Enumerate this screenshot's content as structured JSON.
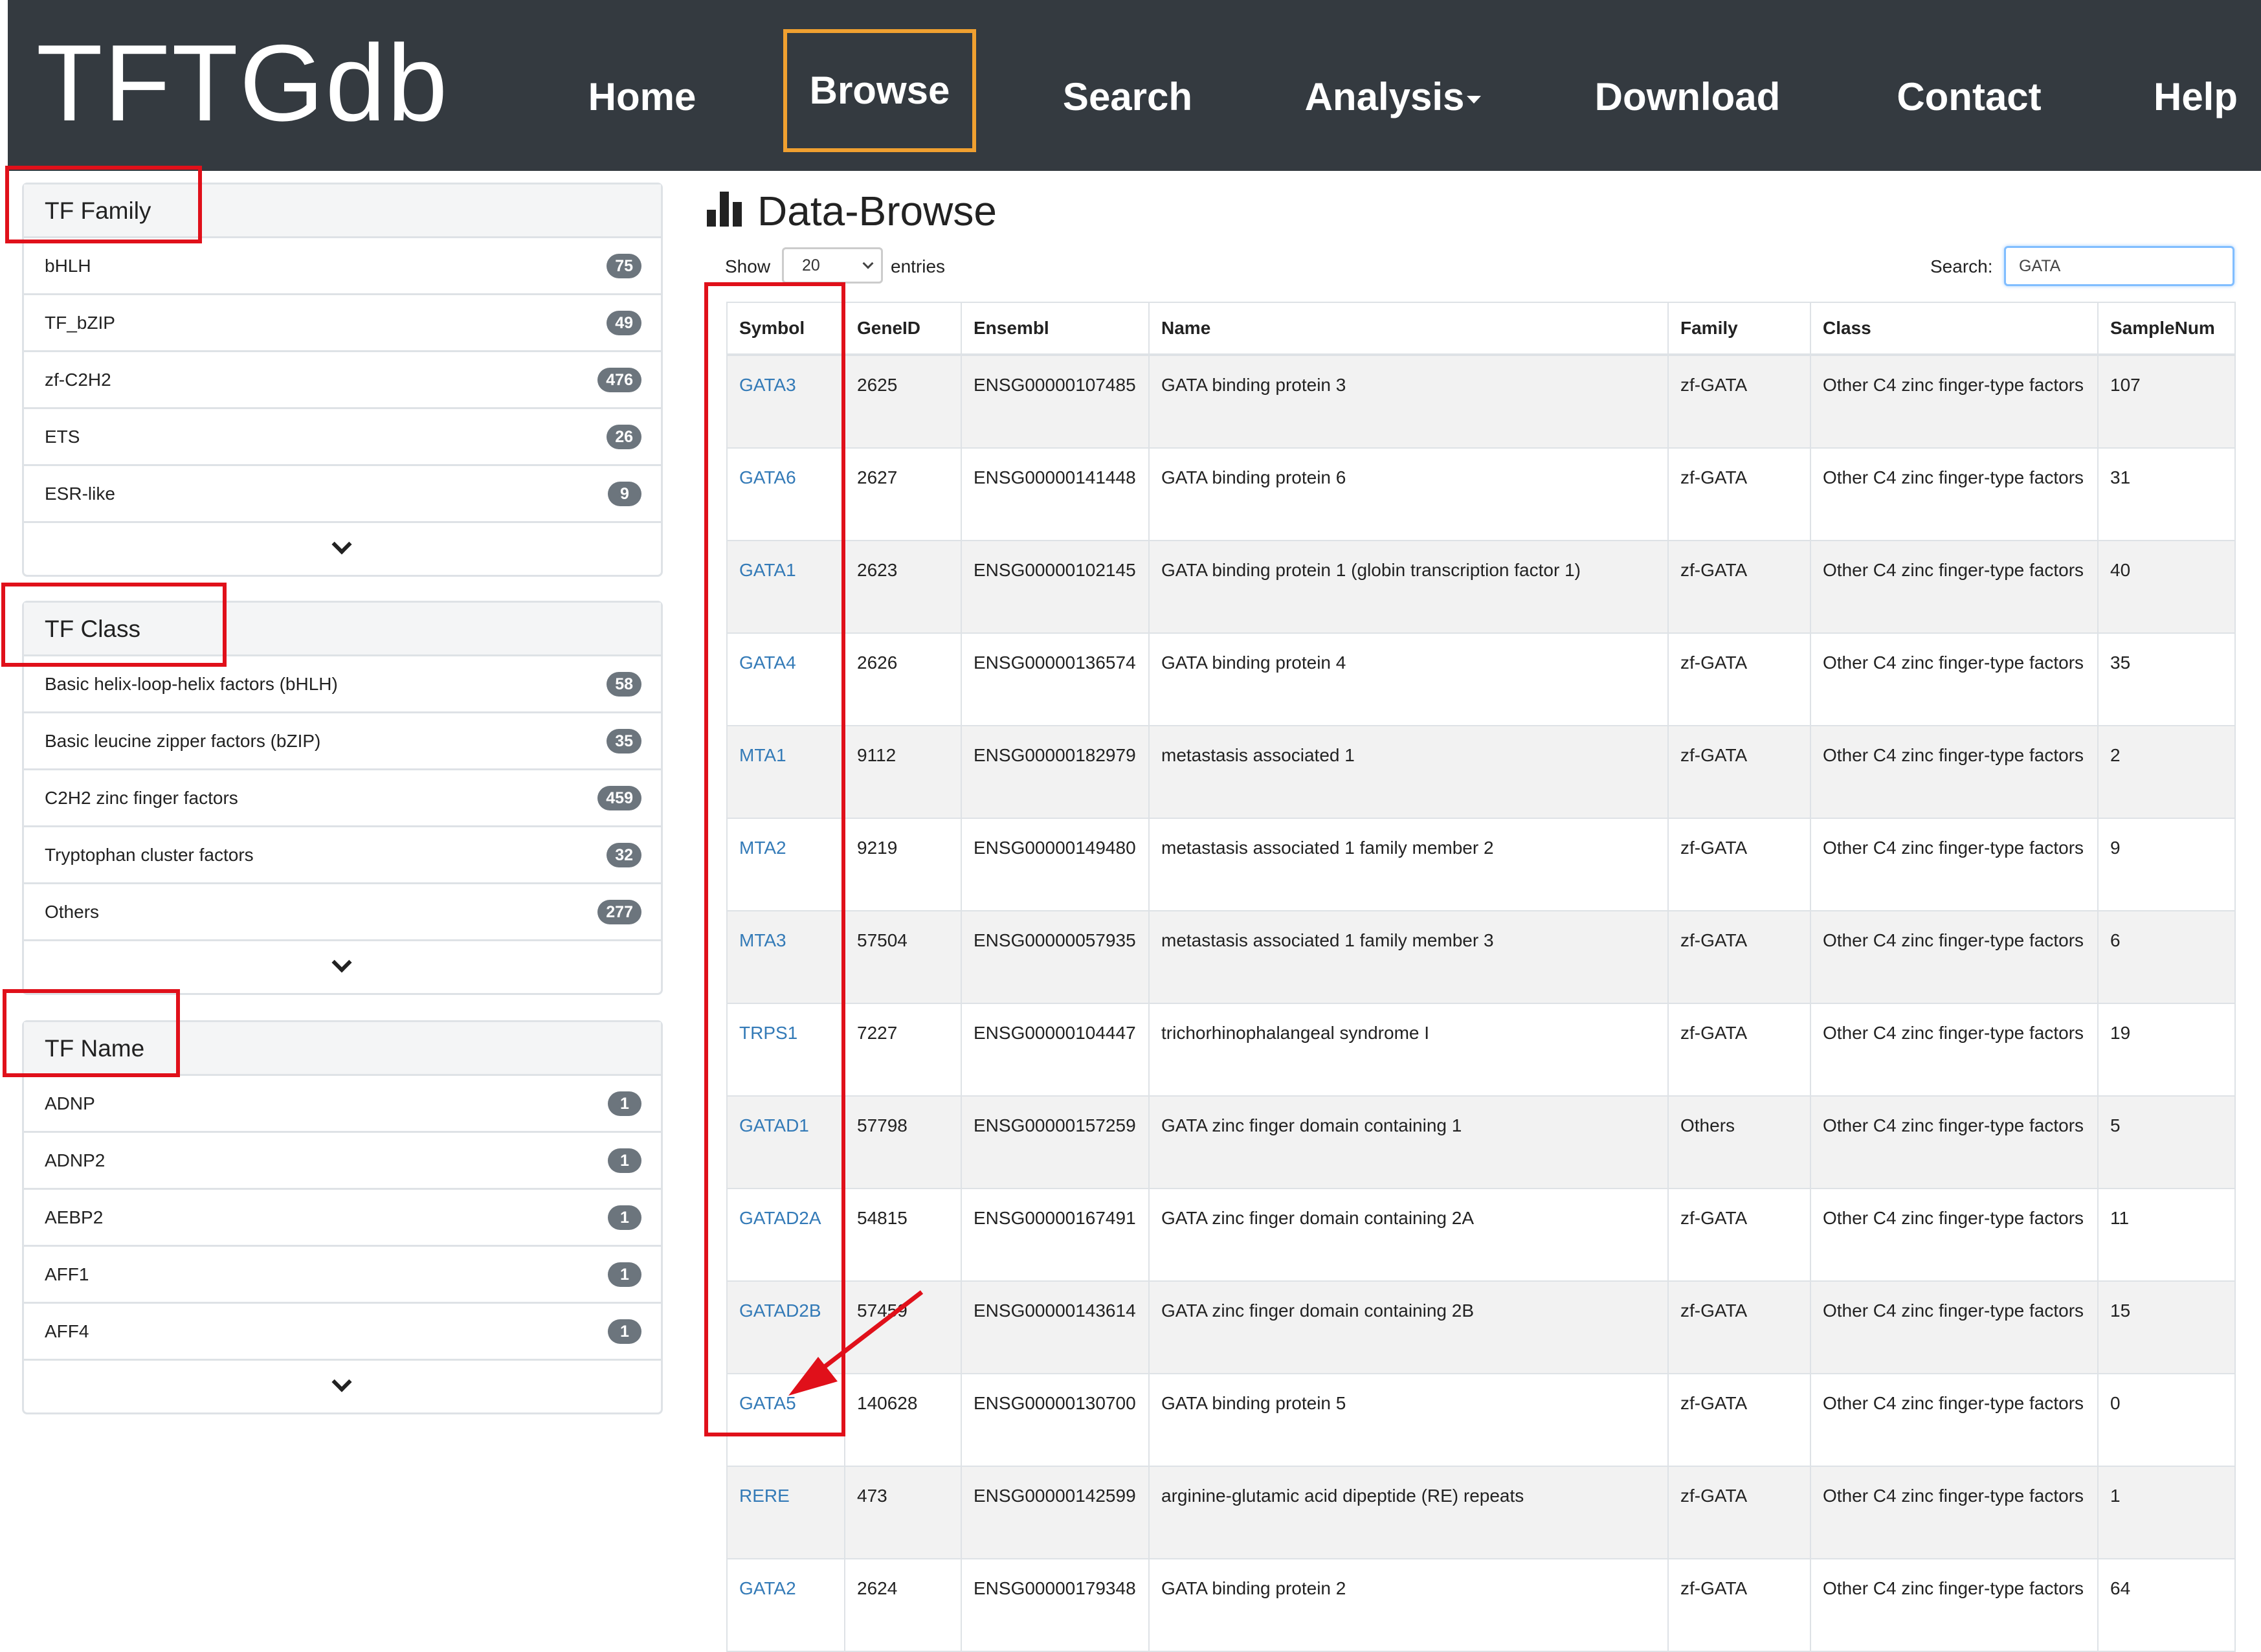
{
  "navbar": {
    "brand": "TFTGdb",
    "items": [
      {
        "label": "Home"
      },
      {
        "label": "Browse"
      },
      {
        "label": "Search"
      },
      {
        "label": "Analysis"
      },
      {
        "label": "Download"
      },
      {
        "label": "Contact"
      },
      {
        "label": "Help"
      }
    ],
    "active": "Browse",
    "active_border_color": "#f0a030"
  },
  "sidebar": {
    "family": {
      "title": "TF Family",
      "items": [
        {
          "label": "bHLH",
          "count": "75"
        },
        {
          "label": "TF_bZIP",
          "count": "49"
        },
        {
          "label": "zf-C2H2",
          "count": "476"
        },
        {
          "label": "ETS",
          "count": "26"
        },
        {
          "label": "ESR-like",
          "count": "9"
        }
      ],
      "expand_icon": "chevron-down-icon"
    },
    "class": {
      "title": "TF Class",
      "items": [
        {
          "label": "Basic helix-loop-helix factors (bHLH)",
          "count": "58"
        },
        {
          "label": "Basic leucine zipper factors (bZIP)",
          "count": "35"
        },
        {
          "label": "C2H2 zinc finger factors",
          "count": "459"
        },
        {
          "label": "Tryptophan cluster factors",
          "count": "32"
        },
        {
          "label": "Others",
          "count": "277"
        }
      ],
      "expand_icon": "chevron-down-icon"
    },
    "name": {
      "title": "TF Name",
      "items": [
        {
          "label": "ADNP",
          "count": "1"
        },
        {
          "label": "ADNP2",
          "count": "1"
        },
        {
          "label": "AEBP2",
          "count": "1"
        },
        {
          "label": "AFF1",
          "count": "1"
        },
        {
          "label": "AFF4",
          "count": "1"
        }
      ],
      "expand_icon": "chevron-down-icon"
    }
  },
  "main": {
    "title": "Data-Browse",
    "title_icon": "bar-chart-icon",
    "show_label": "Show",
    "entries_value": "20",
    "entries_label": "entries",
    "search_label": "Search:",
    "search_value": "GATA",
    "table": {
      "columns": [
        "Symbol",
        "GeneID",
        "Ensembl",
        "Name",
        "Family",
        "Class",
        "SampleNum"
      ],
      "rows": [
        [
          "GATA3",
          "2625",
          "ENSG00000107485",
          "GATA binding protein 3",
          "zf-GATA",
          "Other C4 zinc finger-type factors",
          "107"
        ],
        [
          "GATA6",
          "2627",
          "ENSG00000141448",
          "GATA binding protein 6",
          "zf-GATA",
          "Other C4 zinc finger-type factors",
          "31"
        ],
        [
          "GATA1",
          "2623",
          "ENSG00000102145",
          "GATA binding protein 1 (globin transcription factor 1)",
          "zf-GATA",
          "Other C4 zinc finger-type factors",
          "40"
        ],
        [
          "GATA4",
          "2626",
          "ENSG00000136574",
          "GATA binding protein 4",
          "zf-GATA",
          "Other C4 zinc finger-type factors",
          "35"
        ],
        [
          "MTA1",
          "9112",
          "ENSG00000182979",
          "metastasis associated 1",
          "zf-GATA",
          "Other C4 zinc finger-type factors",
          "2"
        ],
        [
          "MTA2",
          "9219",
          "ENSG00000149480",
          "metastasis associated 1 family member 2",
          "zf-GATA",
          "Other C4 zinc finger-type factors",
          "9"
        ],
        [
          "MTA3",
          "57504",
          "ENSG00000057935",
          "metastasis associated 1 family member 3",
          "zf-GATA",
          "Other C4 zinc finger-type factors",
          "6"
        ],
        [
          "TRPS1",
          "7227",
          "ENSG00000104447",
          "trichorhinophalangeal syndrome I",
          "zf-GATA",
          "Other C4 zinc finger-type factors",
          "19"
        ],
        [
          "GATAD1",
          "57798",
          "ENSG00000157259",
          "GATA zinc finger domain containing 1",
          "Others",
          "Other C4 zinc finger-type factors",
          "5"
        ],
        [
          "GATAD2A",
          "54815",
          "ENSG00000167491",
          "GATA zinc finger domain containing 2A",
          "zf-GATA",
          "Other C4 zinc finger-type factors",
          "11"
        ],
        [
          "GATAD2B",
          "57459",
          "ENSG00000143614",
          "GATA zinc finger domain containing 2B",
          "zf-GATA",
          "Other C4 zinc finger-type factors",
          "15"
        ],
        [
          "GATA5",
          "140628",
          "ENSG00000130700",
          "GATA binding protein 5",
          "zf-GATA",
          "Other C4 zinc finger-type factors",
          "0"
        ],
        [
          "RERE",
          "473",
          "ENSG00000142599",
          "arginine-glutamic acid dipeptide (RE) repeats",
          "zf-GATA",
          "Other C4 zinc finger-type factors",
          "1"
        ],
        [
          "GATA2",
          "2624",
          "ENSG00000179348",
          "GATA binding protein 2",
          "zf-GATA",
          "Other C4 zinc finger-type factors",
          "64"
        ]
      ]
    }
  },
  "annotations": {
    "highlight_color": "#e0101a"
  }
}
